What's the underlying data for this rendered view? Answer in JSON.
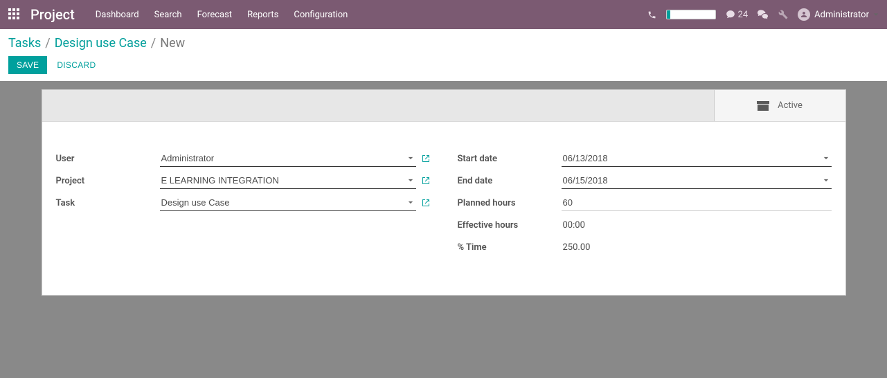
{
  "navbar": {
    "brand": "Project",
    "menu": [
      "Dashboard",
      "Search",
      "Forecast",
      "Reports",
      "Configuration"
    ],
    "messages_count": "24",
    "user_name": "Administrator"
  },
  "breadcrumb": {
    "root": "Tasks",
    "parent": "Design use Case",
    "current": "New"
  },
  "actions": {
    "save": "SAVE",
    "discard": "DISCARD"
  },
  "status": {
    "active_label": "Active"
  },
  "form": {
    "left": {
      "user_label": "User",
      "user_value": "Administrator",
      "project_label": "Project",
      "project_value": "E LEARNING INTEGRATION",
      "task_label": "Task",
      "task_value": "Design use Case"
    },
    "right": {
      "start_date_label": "Start date",
      "start_date_value": "06/13/2018",
      "end_date_label": "End date",
      "end_date_value": "06/15/2018",
      "planned_hours_label": "Planned hours",
      "planned_hours_value": "60",
      "effective_hours_label": "Effective hours",
      "effective_hours_value": "00:00",
      "percent_time_label": "% Time",
      "percent_time_value": "250.00"
    }
  }
}
